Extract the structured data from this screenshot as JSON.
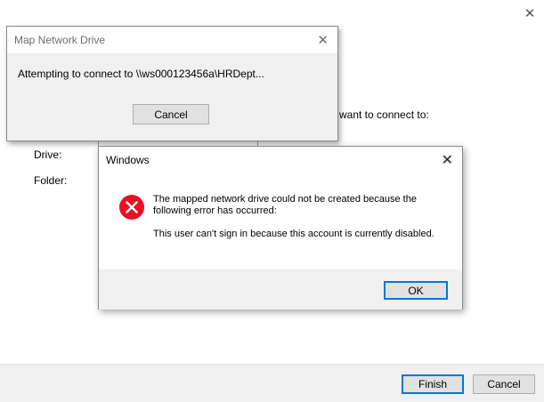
{
  "wizard": {
    "heading_partial": "want to connect to:",
    "drive_label": "Drive:",
    "folder_label": "Folder:",
    "finish_label": "Finish",
    "cancel_label": "Cancel",
    "close_icon": "✕"
  },
  "progress_dialog": {
    "title": "Map Network Drive",
    "message": "Attempting to connect to \\\\ws000123456a\\HRDept...",
    "cancel_label": "Cancel",
    "close_icon": "✕"
  },
  "error_dialog": {
    "title": "Windows",
    "message_line1": "The mapped network drive could not be created because the following error has occurred:",
    "message_line2": "This user can't sign in because this account is currently disabled.",
    "ok_label": "OK",
    "close_icon": "✕",
    "icon": "error-icon",
    "icon_color": "#e81123"
  }
}
